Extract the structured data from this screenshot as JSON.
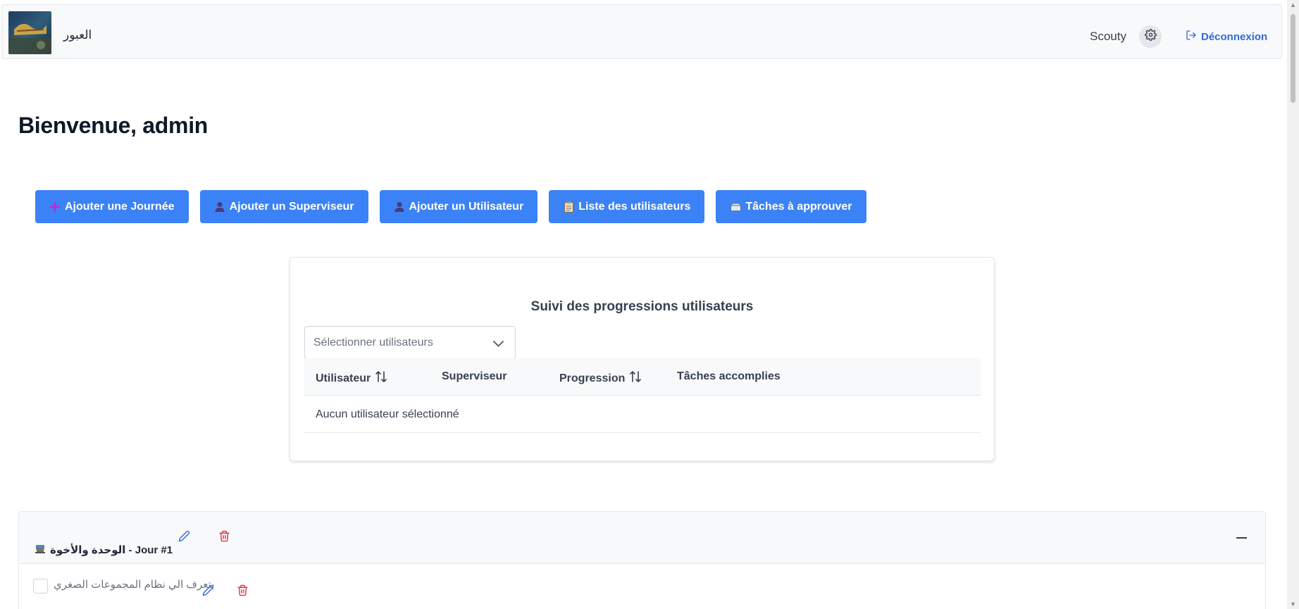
{
  "header": {
    "brand_name": "العبور",
    "user_name": "Scouty",
    "logout_label": "Déconnexion",
    "logo_icon": "logo-image",
    "settings_icon": "gear-icon",
    "logout_icon": "logout-icon"
  },
  "page": {
    "welcome": "Bienvenue, admin"
  },
  "actions": [
    {
      "label": "Ajouter une Journée",
      "icon": "plus-icon"
    },
    {
      "label": "Ajouter un Superviseur",
      "icon": "user-icon"
    },
    {
      "label": "Ajouter un Utilisateur",
      "icon": "user-icon"
    },
    {
      "label": "Liste des utilisateurs",
      "icon": "clipboard-icon"
    },
    {
      "label": "Tâches à approuver",
      "icon": "inbox-icon"
    }
  ],
  "progress": {
    "title": "Suivi des progressions utilisateurs",
    "select_placeholder": "Sélectionner utilisateurs",
    "columns": [
      "Utilisateur",
      "Superviseur",
      "Progression",
      "Tâches accomplies"
    ],
    "empty_message": "Aucun utilisateur sélectionné"
  },
  "day": {
    "title": "الوحدة والأخوة - Jour #1",
    "title_icon": "scout-icon",
    "tasks": [
      {
        "label": "يتعرف الي نظام المجموعات الصغري"
      }
    ]
  },
  "colors": {
    "primary": "#3b82f6",
    "link": "#2f6bd8",
    "danger": "#dc3545",
    "edit": "#2f6bd8"
  }
}
